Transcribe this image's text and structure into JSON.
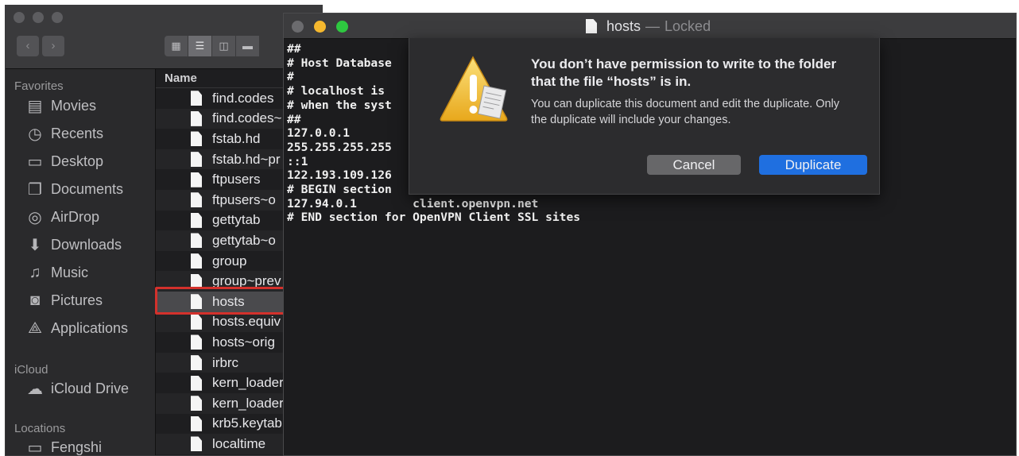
{
  "finder": {
    "sidebar": {
      "sections": [
        {
          "label": "Favorites",
          "items": [
            {
              "label": "Movies",
              "icon": "film-icon"
            },
            {
              "label": "Recents",
              "icon": "clock-icon"
            },
            {
              "label": "Desktop",
              "icon": "desktop-icon"
            },
            {
              "label": "Documents",
              "icon": "documents-icon"
            },
            {
              "label": "AirDrop",
              "icon": "airdrop-icon"
            },
            {
              "label": "Downloads",
              "icon": "downloads-icon"
            },
            {
              "label": "Music",
              "icon": "music-icon"
            },
            {
              "label": "Pictures",
              "icon": "camera-icon"
            },
            {
              "label": "Applications",
              "icon": "applications-icon"
            }
          ]
        },
        {
          "label": "iCloud",
          "items": [
            {
              "label": "iCloud Drive",
              "icon": "cloud-icon"
            }
          ]
        },
        {
          "label": "Locations",
          "items": [
            {
              "label": "Fengshi",
              "icon": "computer-icon"
            }
          ]
        }
      ]
    },
    "list": {
      "column_header": "Name",
      "files": [
        "find.codes",
        "find.codes~",
        "fstab.hd",
        "fstab.hd~pr",
        "ftpusers",
        "ftpusers~o",
        "gettytab",
        "gettytab~o",
        "group",
        "group~prev",
        "hosts",
        "hosts.equiv",
        "hosts~orig",
        "irbrc",
        "kern_loader",
        "kern_loader",
        "krb5.keytab",
        "localtime"
      ],
      "selected": "hosts"
    }
  },
  "editor": {
    "title": "hosts",
    "separator": "—",
    "status": "Locked",
    "lines": [
      "##",
      "# Host Database",
      "#",
      "# localhost is",
      "# when the syst",
      "##",
      "127.0.0.1",
      "255.255.255.255",
      "::1",
      "122.193.109.126",
      "# BEGIN section",
      "127.94.0.1        client.openvpn.net",
      "# END section for OpenVPN Client SSL sites"
    ]
  },
  "alert": {
    "title": "You don’t have permission to write to the folder that the file “hosts” is in.",
    "body": "You can duplicate this document and edit the duplicate. Only the duplicate will include your changes.",
    "cancel_label": "Cancel",
    "duplicate_label": "Duplicate"
  },
  "colors": {
    "accent": "#1f6fe0",
    "highlight": "#d3312c",
    "window_bg": "#1c1c1e"
  }
}
